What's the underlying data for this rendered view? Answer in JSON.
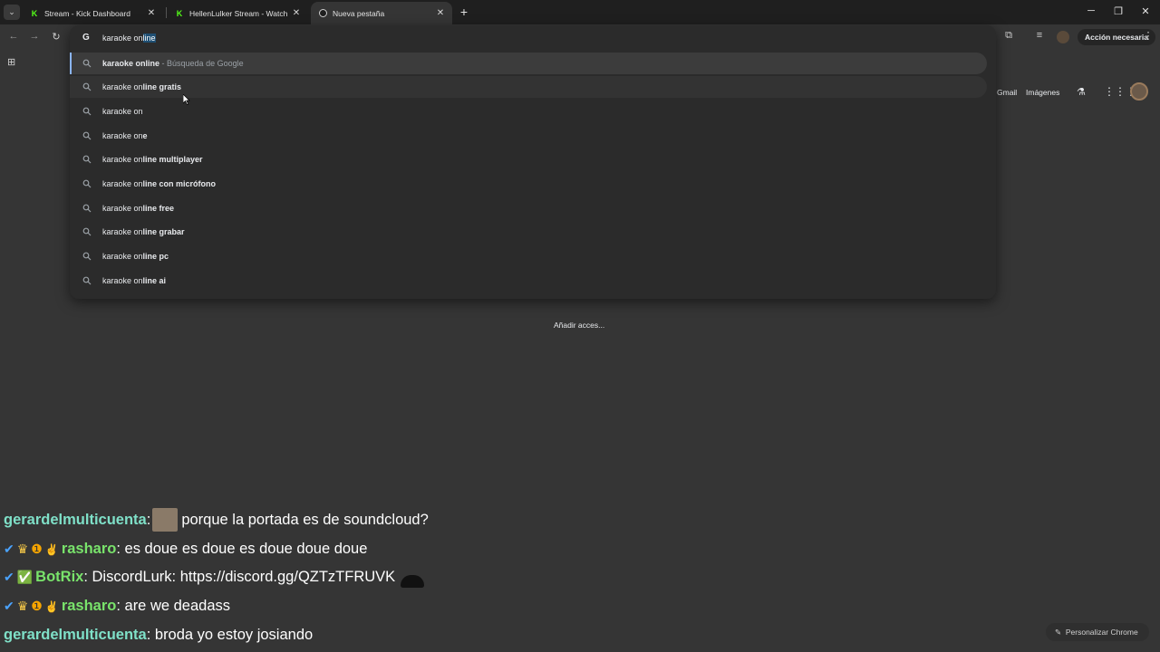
{
  "tabs": [
    {
      "title": "Stream - Kick Dashboard",
      "favicon": "kick-icon",
      "active": false
    },
    {
      "title": "HellenLulker Stream - Watch Li",
      "favicon": "kick-icon",
      "active": false
    },
    {
      "title": "Nueva pestaña",
      "favicon": "chrome-icon",
      "active": true
    }
  ],
  "window_controls": {
    "minimize": "─",
    "restore": "❐",
    "close": "✕"
  },
  "toolbar": {
    "accion_label": "Acción necesaria",
    "menu_glyph": "⋮"
  },
  "omnibox": {
    "typed": "karaoke on",
    "autocomplete": "line",
    "suggestions": [
      {
        "prefix": "karaoke online",
        "suffix": "",
        "desc": " - Búsqueda de Google"
      },
      {
        "prefix": "karaoke on",
        "suffix": "line gratis",
        "desc": ""
      },
      {
        "prefix": "karaoke on",
        "suffix": "",
        "desc": ""
      },
      {
        "prefix": "karaoke on",
        "suffix": "e",
        "desc": ""
      },
      {
        "prefix": "karaoke on",
        "suffix": "line multiplayer",
        "desc": ""
      },
      {
        "prefix": "karaoke on",
        "suffix": "line con micrófono",
        "desc": ""
      },
      {
        "prefix": "karaoke on",
        "suffix": "line free",
        "desc": ""
      },
      {
        "prefix": "karaoke on",
        "suffix": "line grabar",
        "desc": ""
      },
      {
        "prefix": "karaoke on",
        "suffix": "line pc",
        "desc": ""
      },
      {
        "prefix": "karaoke on",
        "suffix": "line ai",
        "desc": ""
      }
    ]
  },
  "google_links": {
    "gmail": "Gmail",
    "imagenes": "Imágenes"
  },
  "shortcut": {
    "label": "Añadir acces..."
  },
  "chat": [
    {
      "user": "gerardelmulticuenta",
      "user_color": "#7fe0c8",
      "message": ": porque la portada es de soundcloud?",
      "badges": ""
    },
    {
      "user": "rasharo",
      "user_color": "#79e36b",
      "message": ": es doue es doue es doue doue doue",
      "badges": "✔👑❶✌"
    },
    {
      "user": "BotRix",
      "user_color": "#79e36b",
      "message": ": DiscordLurk: https://discord.gg/QZTzTFRUVK",
      "badges": "✔✅"
    },
    {
      "user": "rasharo",
      "user_color": "#79e36b",
      "message": ": are we deadass",
      "badges": "✔👑❶✌"
    },
    {
      "user": "gerardelmulticuenta",
      "user_color": "#7fe0c8",
      "message": ": broda yo estoy josiando",
      "badges": ""
    }
  ],
  "personalizar": {
    "label": "Personalizar Chrome"
  }
}
